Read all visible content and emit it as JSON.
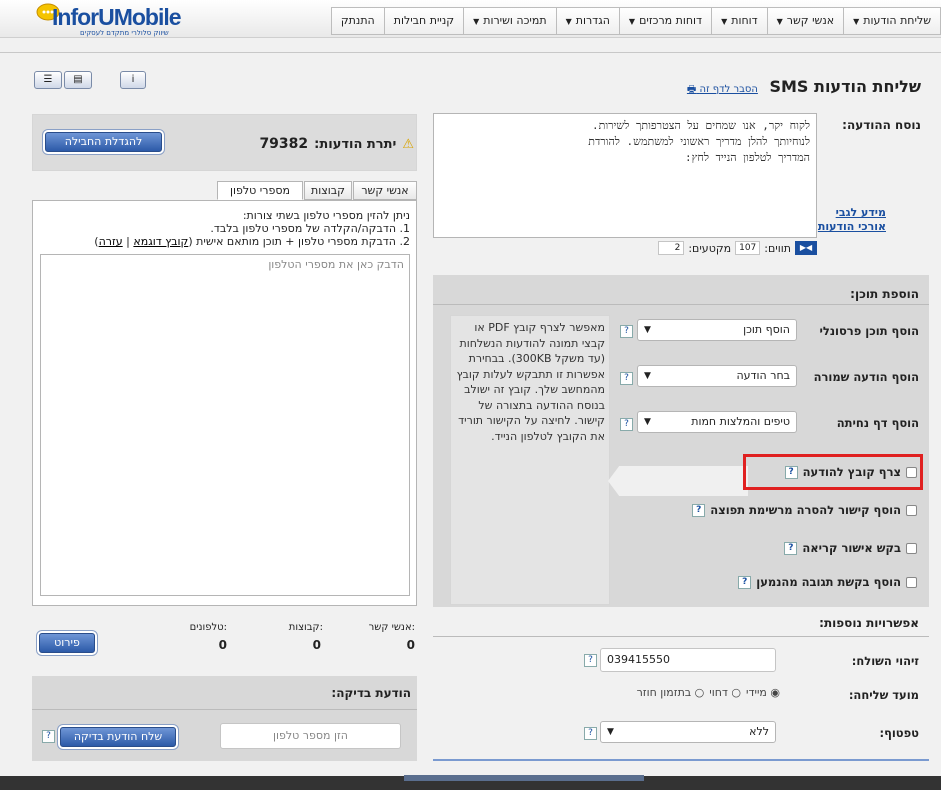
{
  "brand": {
    "name": "InforUMobile",
    "tagline": "שיווק סלולרי מתקדם לעסקים",
    "color": "#1a4fa0"
  },
  "nav": [
    {
      "label": "שליחת הודעות",
      "dd": "▼"
    },
    {
      "label": "אנשי קשר",
      "dd": "▼"
    },
    {
      "label": "דוחות",
      "dd": "▼"
    },
    {
      "label": "דוחות מרכזים",
      "dd": "▼"
    },
    {
      "label": "הגדרות",
      "dd": "▼"
    },
    {
      "label": "תמיכה ושירות",
      "dd": "▼"
    },
    {
      "label": "קניית חבילות",
      "dd": ""
    },
    {
      "label": "התנתק",
      "dd": ""
    }
  ],
  "page": {
    "title": "שליחת הודעות SMS",
    "help_link": "הסבר לדף זה"
  },
  "message": {
    "label": "נוסח ההודעה:",
    "text": "לקוח יקר, אנו שמחים על הצטרפותך לשירות.\nלנוחיותך להלן מדריך ראשוני למשתמש. להורדת\nהמדריך לטלפון הנייד לחץ:",
    "chars_label": "תווים:",
    "chars": "107",
    "segments_label": "מקטעים:",
    "segments": "2",
    "info_link_1": "מידע לגבי",
    "info_link_2": "אורכי הודעות"
  },
  "balance": {
    "label": "יתרת הודעות:",
    "value": "79382",
    "upgrade": "להגדלת החבילה"
  },
  "tabs": [
    "אנשי קשר",
    "קבוצות",
    "מספרי טלפון"
  ],
  "phones": {
    "intro": "ניתן להזין מספרי טלפון בשתי צורות:",
    "opt1": "1. הדבקה/הקלדה של מספרי טלפון בלבד.",
    "opt2_pre": "2. הדבקת מספרי טלפון + תוכן מותאם אישית (",
    "sample_link": "קובץ דוגמא",
    "sep": " | ",
    "help_link": "עזרה",
    "opt2_post": ")",
    "placeholder": "הדבק כאן את מספרי הטלפון"
  },
  "counts": {
    "contacts_label": "אנשי קשר:",
    "contacts": "0",
    "groups_label": "קבוצות:",
    "groups": "0",
    "phones_label": "טלפונים:",
    "phones": "0",
    "details_btn": "פירוט"
  },
  "test": {
    "title": "הודעת בדיקה:",
    "placeholder": "הזן מספר טלפון",
    "send": "שלח הודעת בדיקה"
  },
  "content": {
    "title": "הוספת תוכן:",
    "rows": [
      {
        "label": "הוסף תוכן פרסונלי",
        "value": "הוסף תוכן"
      },
      {
        "label": "הוסף הודעה שמורה",
        "value": "בחר הודעה"
      },
      {
        "label": "הוסף דף נחיתה",
        "value": "טיפים והמלצות חמות"
      }
    ],
    "attach": "צרף קובץ להודעה",
    "unsub": "הוסף קישור להסרה מרשימת תפוצה",
    "read": "בקש אישור קריאה",
    "reply": "הוסף בקשת תגובה מהנמען",
    "tooltip": "מאפשר לצרף קובץ PDF או קבצי תמונה להודעות הנשלחות (עד משקל 300KB). בבחירת אפשרות זו תתבקש לעלות קובץ מהמחשב שלך. קובץ זה ישולב בנוסח ההודעה בתצורה של קישור. לחיצה על הקישור תוריד את הקובץ לטלפון הנייד.",
    "highlight": "#e02020"
  },
  "more": {
    "title": "אפשרויות נוספות:",
    "sender_label": "זיהוי השולח:",
    "sender": "039415550",
    "timing_label": "מועד שליחה:",
    "timing": [
      "מיידי",
      "דחוי",
      "בתזמון חוזר"
    ],
    "format_label": "טפטוף:",
    "format": "ללא"
  },
  "q": "?"
}
